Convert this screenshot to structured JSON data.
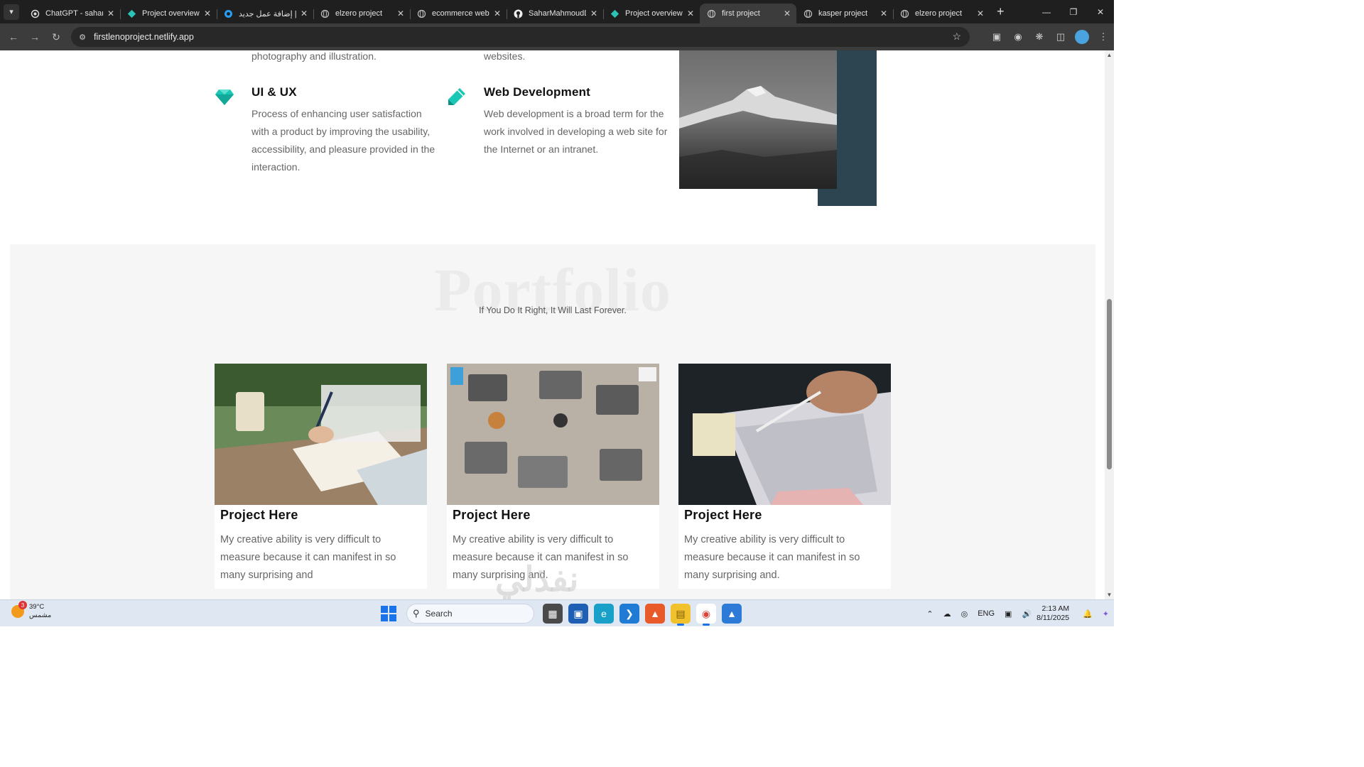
{
  "browser": {
    "tabs": [
      {
        "label": "ChatGPT - sahar",
        "icon": "openai-icon",
        "active": false
      },
      {
        "label": "Project overview |",
        "icon": "netlify-icon",
        "active": false
      },
      {
        "label": "إضافة عمل جديد |",
        "icon": "circle-icon",
        "active": false
      },
      {
        "label": "elzero project",
        "icon": "globe-icon",
        "active": false
      },
      {
        "label": "ecommerce websi",
        "icon": "globe-icon",
        "active": false
      },
      {
        "label": "SaharMahmoudD",
        "icon": "github-icon",
        "active": false
      },
      {
        "label": "Project overview |",
        "icon": "netlify-icon",
        "active": false
      },
      {
        "label": "first project",
        "icon": "globe-icon",
        "active": true
      },
      {
        "label": "kasper project",
        "icon": "globe-icon",
        "active": false
      },
      {
        "label": "elzero project",
        "icon": "globe-icon",
        "active": false
      }
    ],
    "url": "firstlenoproject.netlify.app"
  },
  "services": {
    "frag_left": "photography and illustration.",
    "frag_right": "websites.",
    "items": [
      {
        "title": "UI & UX",
        "text": "Process of enhancing user satisfaction with a product by improving the usability, accessibility, and pleasure provided in the interaction.",
        "icon": "diamond-icon"
      },
      {
        "title": "Web Development",
        "text": "Web development is a broad term for the work involved in developing a web site for the Internet or an intranet.",
        "icon": "pencil-icon"
      }
    ]
  },
  "portfolio": {
    "title": "Portfolio",
    "subtitle": "If You Do It Right, It Will Last Forever.",
    "cards": [
      {
        "title": "Project Here",
        "text": "My creative ability is very difficult to measure because it can manifest in so many surprising and"
      },
      {
        "title": "Project Here",
        "text": "My creative ability is very difficult to measure because it can manifest in so many surprising and."
      },
      {
        "title": "Project Here",
        "text": "My creative ability is very difficult to measure because it can manifest in so many surprising and."
      }
    ]
  },
  "watermark": "نفذلي",
  "taskbar": {
    "weather_temp": "39°C",
    "weather_desc": "مشمس",
    "weather_badge": "3",
    "search_placeholder": "Search",
    "lang": "ENG",
    "time": "2:13 AM",
    "date": "8/11/2025"
  },
  "colors": {
    "accent": "#19c8b4",
    "skills_dark": "#2c4551",
    "portfolio_bg": "#f6f6f6"
  }
}
